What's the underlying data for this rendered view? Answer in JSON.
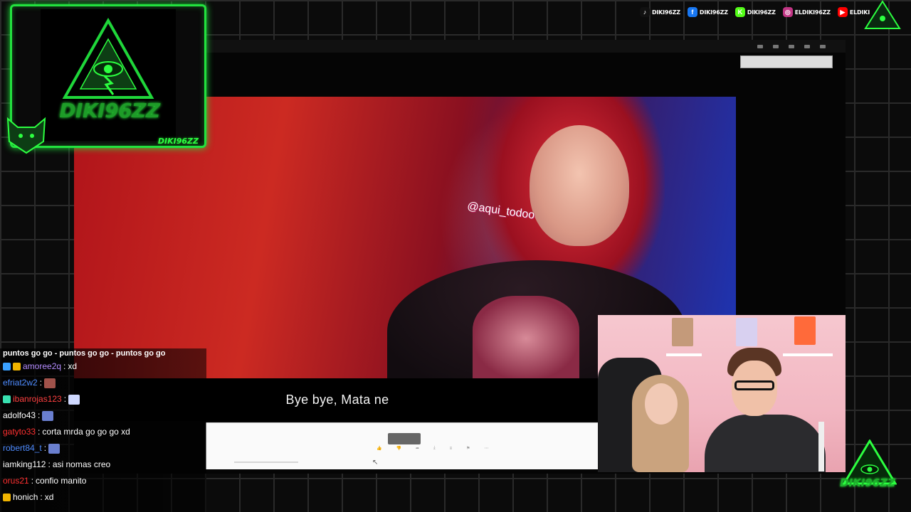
{
  "socials": [
    {
      "platform": "tiktok",
      "icon": "tiktok-icon",
      "glyph": "♪",
      "color": "#111111",
      "label": "DIKI96ZZ"
    },
    {
      "platform": "facebook",
      "icon": "facebook-icon",
      "glyph": "f",
      "color": "#1877f2",
      "label": "DIKI96ZZ"
    },
    {
      "platform": "kick",
      "icon": "kick-icon",
      "glyph": "K",
      "color": "#53fc18",
      "label": "DIKI96ZZ"
    },
    {
      "platform": "instagram",
      "icon": "instagram-icon",
      "glyph": "◎",
      "color": "#c13584",
      "label": "ELDIKI96ZZ"
    },
    {
      "platform": "youtube",
      "icon": "youtube-icon",
      "glyph": "▶",
      "color": "#ff0000",
      "label": "ELDIKI"
    }
  ],
  "logo": {
    "title": "DIKI96ZZ",
    "caption": "DIKI96ZZ"
  },
  "bottom_logo": {
    "title": "DIKI96ZZ"
  },
  "video": {
    "watermark": "@aqui_todoo",
    "subtitle": "Bye bye, Mata ne"
  },
  "chat": {
    "top_line": "puntos go go - puntos go go - puntos go go",
    "messages": [
      {
        "user": "amoree2q",
        "user_color": "#b48cff",
        "badges": [
          "#3aa0ff",
          "#f0b400"
        ],
        "text": "xd",
        "emote": null
      },
      {
        "user": "efriat2w2",
        "user_color": "#4f8cff",
        "badges": [],
        "text": "",
        "emote": "#a0524a"
      },
      {
        "user": "ibanrojas123",
        "user_color": "#ff4040",
        "badges": [
          "#38e0b0"
        ],
        "text": "",
        "emote": "#cfd8ff"
      },
      {
        "user": "adolfo43",
        "user_color": "#ffffff",
        "badges": [],
        "text": "",
        "emote": "#6a7fcf"
      },
      {
        "user": "gatyto33",
        "user_color": "#ff3030",
        "badges": [],
        "text": "corta mrda go go go xd",
        "emote": null
      },
      {
        "user": "robert84_t",
        "user_color": "#4f8cff",
        "badges": [],
        "text": "",
        "emote": "#6a7fcf"
      },
      {
        "user": "iamking112",
        "user_color": "#ffffff",
        "badges": [],
        "text": "asi nomas creo",
        "emote": null
      },
      {
        "user": "orus21",
        "user_color": "#ff3030",
        "badges": [],
        "text": "confio manito",
        "emote": null
      },
      {
        "user": "honich",
        "user_color": "#ffffff",
        "badges": [
          "#f0b400"
        ],
        "text": "xd",
        "emote": null
      }
    ]
  }
}
